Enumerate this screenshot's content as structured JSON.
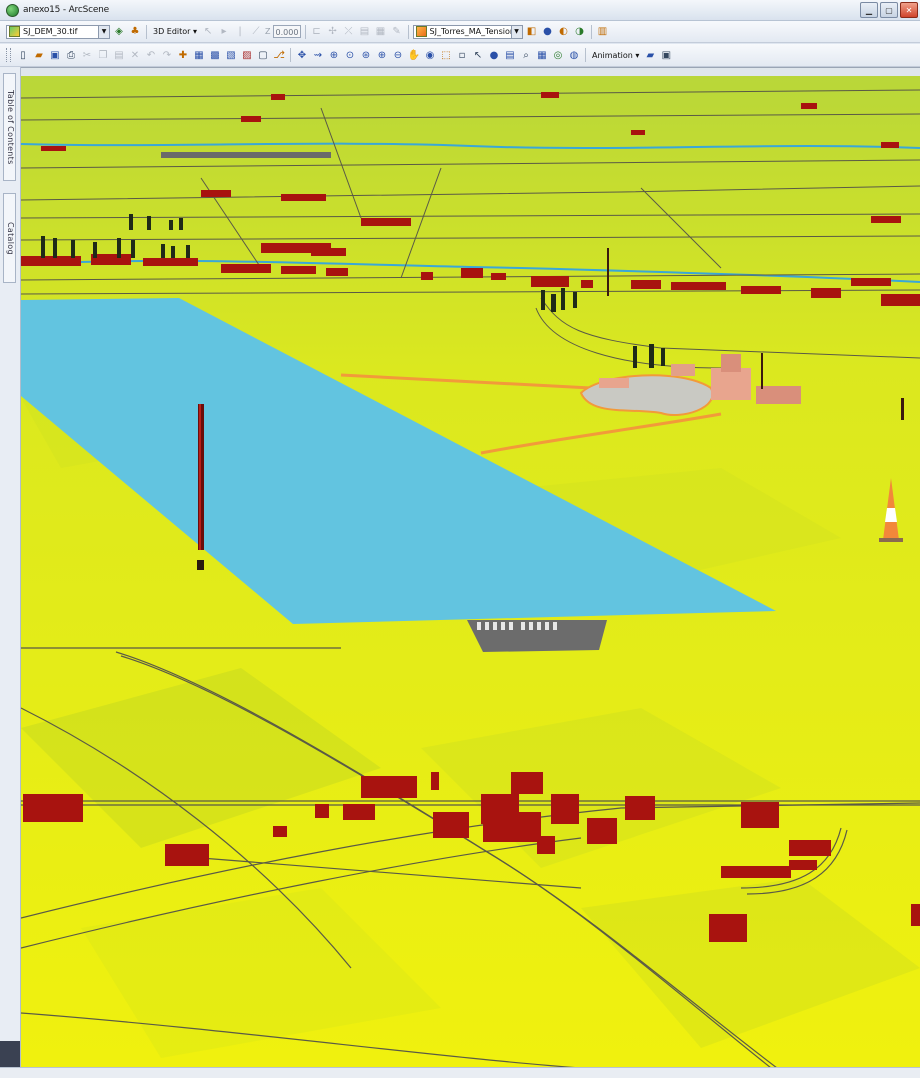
{
  "window": {
    "title": "anexo15 - ArcScene",
    "icon": "arcscene-globe-icon"
  },
  "toolbar1": {
    "layer_combo": "SJ_DEM_30.tif",
    "editor_menu": "3D Editor",
    "z_label": "Z",
    "z_value": "0.000",
    "target_layer_combo": "SJ_Torres_MA_Tension"
  },
  "toolbar2": {
    "animation_menu": "Animation"
  },
  "side_panel": {
    "toc_tab": "Table of Contents",
    "catalog_tab": "Catalog"
  },
  "colors": {
    "terrain": "#e6ee1a",
    "water_body": "#62c4e0",
    "buildings": "#a8130f",
    "roads": "#5a5a46",
    "runway": "#6c6c6c",
    "river": "#3aa7d8",
    "orange_path": "#f29a3a",
    "sky": "#dfe6ec"
  }
}
